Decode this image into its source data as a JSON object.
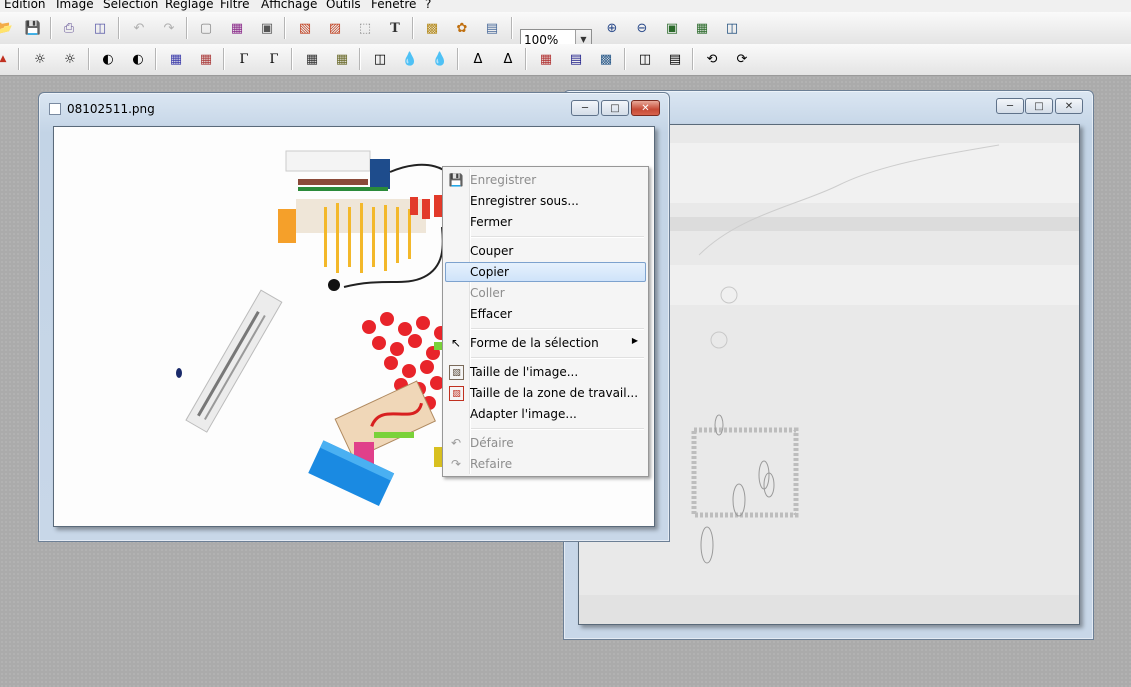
{
  "menubar": {
    "items": [
      "Edition",
      "Image",
      "Sélection",
      "Réglage",
      "Filtre",
      "Affichage",
      "Outils",
      "Fenêtre",
      "?"
    ]
  },
  "toolbar": {
    "zoom_value": "100%"
  },
  "window_main": {
    "title": "08102511.png"
  },
  "window_second": {
    "title": ""
  },
  "context_menu": {
    "items": [
      {
        "label": "Enregistrer",
        "enabled": false,
        "icon": "save-icon"
      },
      {
        "label": "Enregistrer sous...",
        "enabled": true
      },
      {
        "label": "Fermer",
        "enabled": true
      },
      {
        "label": "Couper",
        "enabled": true
      },
      {
        "label": "Copier",
        "enabled": true,
        "highlighted": true
      },
      {
        "label": "Coller",
        "enabled": false
      },
      {
        "label": "Effacer",
        "enabled": true
      },
      {
        "label": "Forme de la sélection",
        "enabled": true,
        "icon": "cursor-icon",
        "submenu": true
      },
      {
        "label": "Taille de l'image...",
        "enabled": true,
        "icon": "image-resize-icon"
      },
      {
        "label": "Taille de la zone de travail...",
        "enabled": true,
        "icon": "canvas-resize-icon"
      },
      {
        "label": "Adapter l'image...",
        "enabled": true
      },
      {
        "label": "Défaire",
        "enabled": false,
        "icon": "undo-icon"
      },
      {
        "label": "Refaire",
        "enabled": false,
        "icon": "redo-icon"
      }
    ]
  },
  "colors": {
    "highlight": "#cfe3fa",
    "highlight_border": "#7da2ce",
    "close_button": "#c64a36",
    "workspace": "#ababab"
  }
}
